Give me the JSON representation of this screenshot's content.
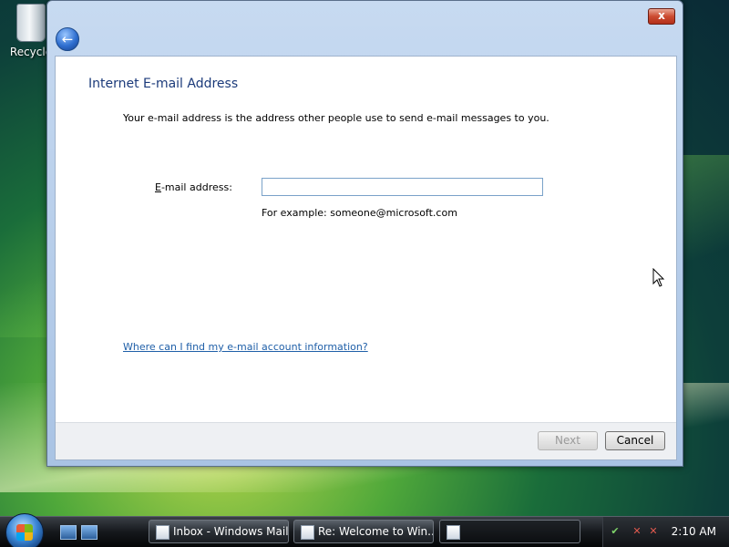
{
  "desktop": {
    "recycle_bin_label": "Recycle"
  },
  "dialog": {
    "close_label": "x",
    "back_icon": "arrow-left-icon",
    "heading": "Internet E-mail Address",
    "intro": "Your e-mail address is the address other people use to send e-mail messages to you.",
    "field_label_prefix": "E",
    "field_label_rest": "-mail address:",
    "email_value": "",
    "example": "For example: someone@microsoft.com",
    "help_link": "Where can I find my e-mail account information?",
    "next_label": "Next",
    "cancel_label": "Cancel"
  },
  "taskbar": {
    "items": [
      {
        "label": "Inbox - Windows Mail"
      },
      {
        "label": "Re: Welcome to Win..."
      },
      {
        "label": ""
      }
    ],
    "clock": "2:10 AM"
  }
}
